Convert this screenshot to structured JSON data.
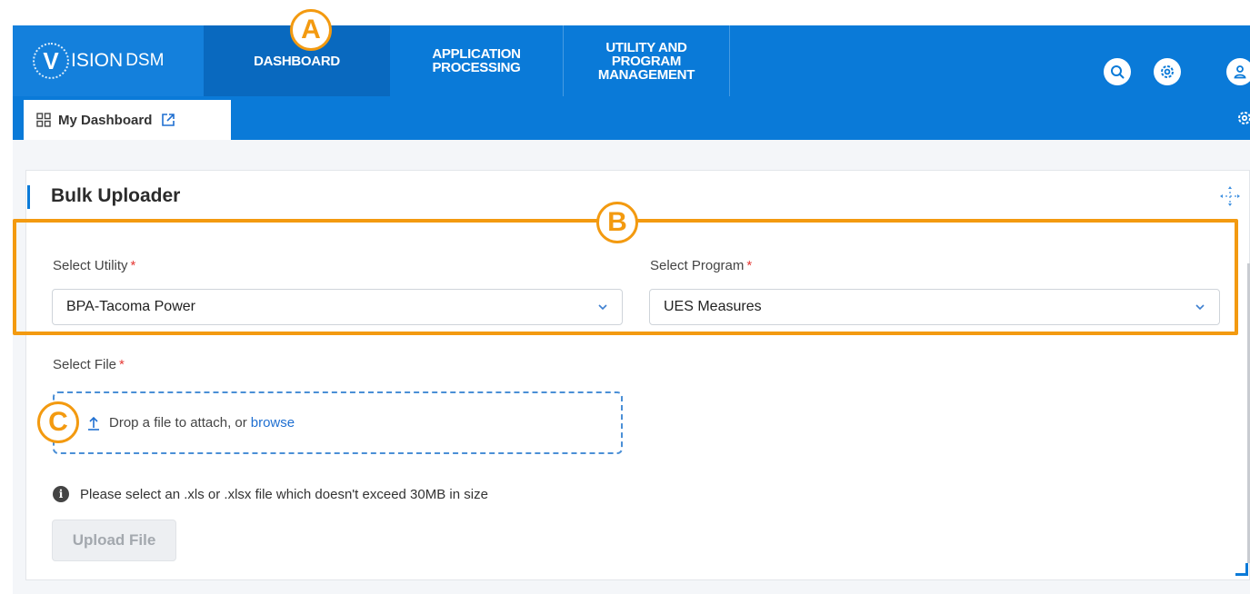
{
  "nav": {
    "logo_v": "V",
    "logo_word": "ISION",
    "logo_dsm": "DSM",
    "tabs": [
      {
        "label": "DASHBOARD"
      },
      {
        "label": "APPLICATION\nPROCESSING"
      },
      {
        "label": "UTILITY AND\nPROGRAM\nMANAGEMENT"
      }
    ],
    "icons": [
      "search-icon",
      "gear-icon",
      "user-icon"
    ]
  },
  "subnav": {
    "tab_label": "My Dashboard",
    "tab_icon": "grid-icon",
    "tab_link_icon": "external-link-icon"
  },
  "card": {
    "title": "Bulk Uploader",
    "utility": {
      "label": "Select Utility",
      "required_mark": "*",
      "value": "BPA-Tacoma Power"
    },
    "program": {
      "label": "Select Program",
      "required_mark": "*",
      "value": "UES Measures"
    },
    "file": {
      "label": "Select File",
      "required_mark": "*",
      "drop_text": "Drop a file to attach, or",
      "browse_text": "browse"
    },
    "hint": "Please select an .xls or .xlsx file which doesn't exceed 30MB in size",
    "upload_button": "Upload File"
  },
  "annotations": {
    "a": "A",
    "b": "B",
    "c": "C",
    "color": "#f39a10"
  },
  "colors": {
    "brand_blue": "#0a7ad8",
    "active_tab": "#0969bf",
    "required": "#e53935",
    "link": "#1f6fd1"
  }
}
